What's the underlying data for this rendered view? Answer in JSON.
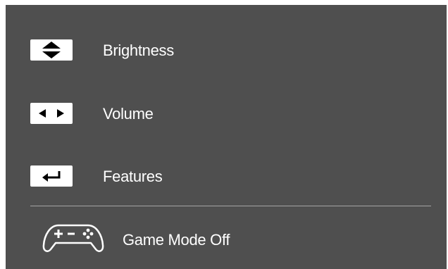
{
  "menu": {
    "items": [
      {
        "key_icon": "up-down-arrows-icon",
        "label": "Brightness"
      },
      {
        "key_icon": "left-right-arrows-icon",
        "label": "Volume"
      },
      {
        "key_icon": "enter-return-icon",
        "label": "Features"
      }
    ],
    "game_mode": {
      "icon": "gamepad-icon",
      "label": "Game Mode Off"
    }
  },
  "colors": {
    "panel_background": "#4f4f4f",
    "text": "#ffffff",
    "key_background": "#ffffff",
    "key_glyph": "#000000",
    "divider": "#a5a5a5"
  }
}
